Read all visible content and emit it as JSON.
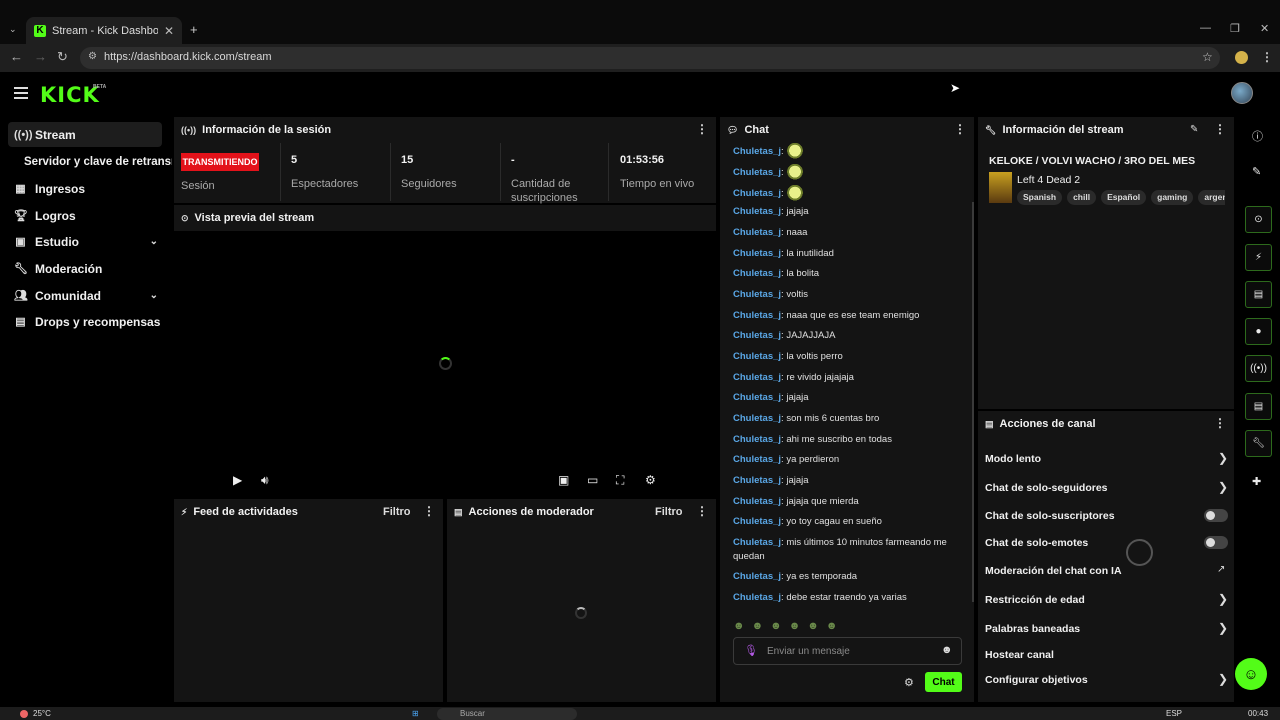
{
  "browser": {
    "tab_title": "Stream - Kick Dashboard",
    "url": "https://dashboard.kick.com/stream"
  },
  "header": {
    "logo": "KICK",
    "badge": "BETA"
  },
  "sidebar": {
    "items": [
      {
        "label": "Stream",
        "icon": "broadcast-icon"
      },
      {
        "label": "Servidor y clave de retransm",
        "icon": ""
      },
      {
        "label": "Ingresos",
        "icon": "chart-icon"
      },
      {
        "label": "Logros",
        "icon": "trophy-icon"
      },
      {
        "label": "Estudio",
        "icon": "studio-icon"
      },
      {
        "label": "Moderación",
        "icon": "wrench-icon"
      },
      {
        "label": "Comunidad",
        "icon": "people-icon"
      },
      {
        "label": "Drops y recompensas",
        "icon": "gift-icon"
      }
    ]
  },
  "session": {
    "title": "Información de la sesión",
    "status": "TRANSMITIENDO",
    "status_label": "Sesión",
    "stats": [
      {
        "value": "5",
        "label": "Espectadores"
      },
      {
        "value": "15",
        "label": "Seguidores"
      },
      {
        "value": "-",
        "label": "Cantidad de suscripciones"
      },
      {
        "value": "01:53:56",
        "label": "Tiempo en vivo"
      }
    ]
  },
  "preview": {
    "title": "Vista previa del stream"
  },
  "activity": {
    "title": "Feed de actividades",
    "filter": "Filtro"
  },
  "modactions": {
    "title": "Acciones de moderador",
    "filter": "Filtro"
  },
  "chat": {
    "title": "Chat",
    "messages": [
      {
        "user": "Chuletas_j",
        "text": ""
      },
      {
        "user": "Chuletas_j",
        "text": ""
      },
      {
        "user": "Chuletas_j",
        "text": ""
      },
      {
        "user": "Chuletas_j",
        "text": "jajaja"
      },
      {
        "user": "Chuletas_j",
        "text": "naaa"
      },
      {
        "user": "Chuletas_j",
        "text": "la inutilidad"
      },
      {
        "user": "Chuletas_j",
        "text": "la bolita"
      },
      {
        "user": "Chuletas_j",
        "text": "voltis"
      },
      {
        "user": "Chuletas_j",
        "text": "naaa que es ese team enemigo"
      },
      {
        "user": "Chuletas_j",
        "text": "JAJAJJAJA"
      },
      {
        "user": "Chuletas_j",
        "text": "la voltis perro"
      },
      {
        "user": "Chuletas_j",
        "text": "re vivido jajajaja"
      },
      {
        "user": "Chuletas_j",
        "text": "jajaja"
      },
      {
        "user": "Chuletas_j",
        "text": "son mis 6 cuentas bro"
      },
      {
        "user": "Chuletas_j",
        "text": "ahi me suscribo en todas"
      },
      {
        "user": "Chuletas_j",
        "text": "ya perdieron"
      },
      {
        "user": "Chuletas_j",
        "text": "jajaja"
      },
      {
        "user": "Chuletas_j",
        "text": "jajaja que mierda"
      },
      {
        "user": "Chuletas_j",
        "text": "yo toy cagau en sueño"
      },
      {
        "user": "Chuletas_j",
        "text": "mis últimos 10 minutos farmeando me quedan"
      },
      {
        "user": "Chuletas_j",
        "text": "ya es temporada"
      },
      {
        "user": "Chuletas_j",
        "text": "debe estar traendo ya varias"
      }
    ],
    "input_placeholder": "Enviar un mensaje",
    "send_label": "Chat"
  },
  "streaminfo": {
    "title": "Información del stream",
    "stream_title": "KELOKE / VOLVI WACHO / 3RO DEL MES",
    "game": "Left 4 Dead 2",
    "tags": [
      "Spanish",
      "chill",
      "Español",
      "gaming",
      "argentina"
    ]
  },
  "channel_actions": {
    "title": "Acciones de canal",
    "items": [
      {
        "label": "Modo lento",
        "control": "chevron"
      },
      {
        "label": "Chat de solo-seguidores",
        "control": "chevron"
      },
      {
        "label": "Chat de solo-suscriptores",
        "control": "toggle"
      },
      {
        "label": "Chat de solo-emotes",
        "control": "toggle"
      },
      {
        "label": "Moderación del chat con IA",
        "control": "external"
      },
      {
        "label": "Restricción de edad",
        "control": "chevron"
      },
      {
        "label": "Palabras baneadas",
        "control": "chevron"
      },
      {
        "label": "Hostear canal",
        "control": "none"
      },
      {
        "label": "Configurar objetivos",
        "control": "chevron"
      }
    ]
  },
  "taskbar": {
    "weather": "25°C",
    "search": "Buscar",
    "lang": "ESP",
    "time": "00:43"
  },
  "colors": {
    "accent": "#53fc18",
    "live": "#e3121a",
    "username": "#5aa7e6"
  }
}
